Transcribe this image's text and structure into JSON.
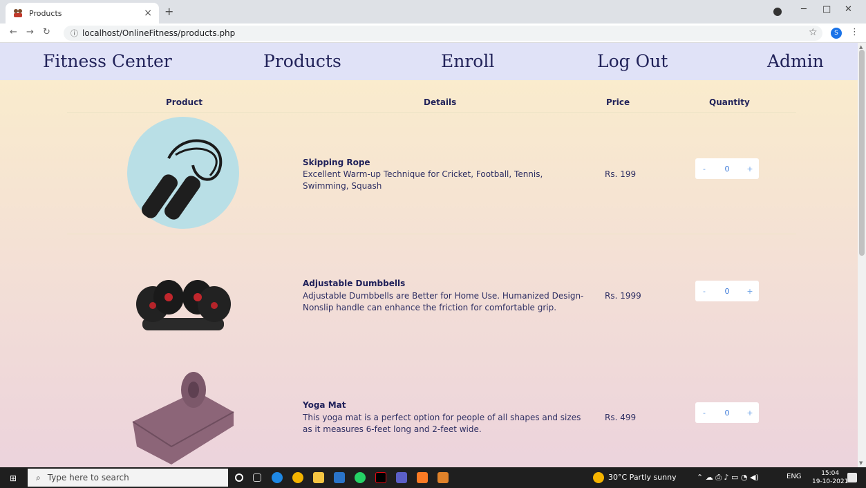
{
  "browser": {
    "tab_title": "Products",
    "tab_close": "×",
    "new_tab": "+",
    "url": "localhost/OnlineFitness/products.php",
    "profile_initial": "S"
  },
  "nav": {
    "items": [
      "Fitness Center",
      "Products",
      "Enroll",
      "Log Out",
      "Admin"
    ]
  },
  "table": {
    "headers": [
      "Product",
      "Details",
      "Price",
      "Quantity"
    ],
    "rows": [
      {
        "name": "Skipping Rope",
        "description": "Excellent Warm-up Technique for Cricket, Football, Tennis, Swimming, Squash",
        "price": "Rs. 199",
        "quantity": "0",
        "image_icon": "skipping-rope-icon"
      },
      {
        "name": "Adjustable Dumbbells",
        "description": "Adjustable Dumbbells are Better for Home Use. Humanized Design- Nonslip handle can enhance the friction for comfortable grip.",
        "price": "Rs. 1999",
        "quantity": "0",
        "image_icon": "dumbbells-icon"
      },
      {
        "name": "Yoga Mat",
        "description": "This yoga mat is a perfect option for people of all shapes and sizes as it measures 6-feet long and 2-feet wide.",
        "price": "Rs. 499",
        "quantity": "0",
        "image_icon": "yoga-mat-icon"
      }
    ],
    "decrement": "-",
    "increment": "+"
  },
  "taskbar": {
    "search_placeholder": "Type here to search",
    "weather": "30°C  Partly sunny",
    "lang": "ENG",
    "time": "15:04",
    "date": "19-10-2021"
  },
  "colors": {
    "nav_bg": "#e0e2f7",
    "nav_text": "#22235a",
    "accent_blue": "#3a78d8"
  }
}
